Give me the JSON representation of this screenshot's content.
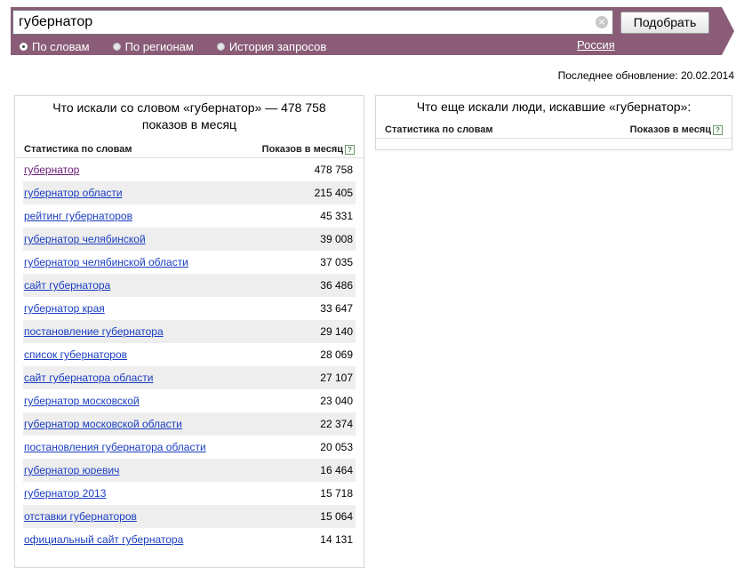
{
  "search": {
    "value": "губернатор",
    "clear_glyph": "×",
    "submit_label": "Подобрать"
  },
  "modes": [
    {
      "label": "По словам",
      "selected": true
    },
    {
      "label": "По регионам",
      "selected": false
    },
    {
      "label": "История запросов",
      "selected": false
    }
  ],
  "region_label": "Россия",
  "last_update": "Последнее обновление: 20.02.2014",
  "left_panel": {
    "title_line1": "Что искали со словом «губернатор» — 478 758",
    "title_line2": "показов в месяц",
    "col_stats": "Статистика по словам",
    "col_shows": "Показов в месяц",
    "help_glyph": "?",
    "rows": [
      {
        "phrase": "губернатор",
        "count": "478 758"
      },
      {
        "phrase": "губернатор области",
        "count": "215 405"
      },
      {
        "phrase": "рейтинг губернаторов",
        "count": "45 331"
      },
      {
        "phrase": "губернатор челябинской",
        "count": "39 008"
      },
      {
        "phrase": "губернатор челябинской области",
        "count": "37 035"
      },
      {
        "phrase": "сайт губернатора",
        "count": "36 486"
      },
      {
        "phrase": "губернатор края",
        "count": "33 647"
      },
      {
        "phrase": "постановление губернатора",
        "count": "29 140"
      },
      {
        "phrase": "список губернаторов",
        "count": "28 069"
      },
      {
        "phrase": "сайт губернатора области",
        "count": "27 107"
      },
      {
        "phrase": "губернатор московской",
        "count": "23 040"
      },
      {
        "phrase": "губернатор московской области",
        "count": "22 374"
      },
      {
        "phrase": "постановления губернатора области",
        "count": "20 053"
      },
      {
        "phrase": "губернатор юревич",
        "count": "16 464"
      },
      {
        "phrase": "губернатор 2013",
        "count": "15 718"
      },
      {
        "phrase": "отставки губернаторов",
        "count": "15 064"
      },
      {
        "phrase": "официальный сайт губернатора",
        "count": "14 131"
      }
    ]
  },
  "right_panel": {
    "title": "Что еще искали люди, искавшие «губернатор»:",
    "col_stats": "Статистика по словам",
    "col_shows": "Показов в месяц",
    "help_glyph": "?"
  },
  "colors": {
    "header_band": "#8a5c78",
    "link": "#1a3dc1",
    "visited_link": "#6a1b78",
    "row_alt": "#eeeeee"
  }
}
